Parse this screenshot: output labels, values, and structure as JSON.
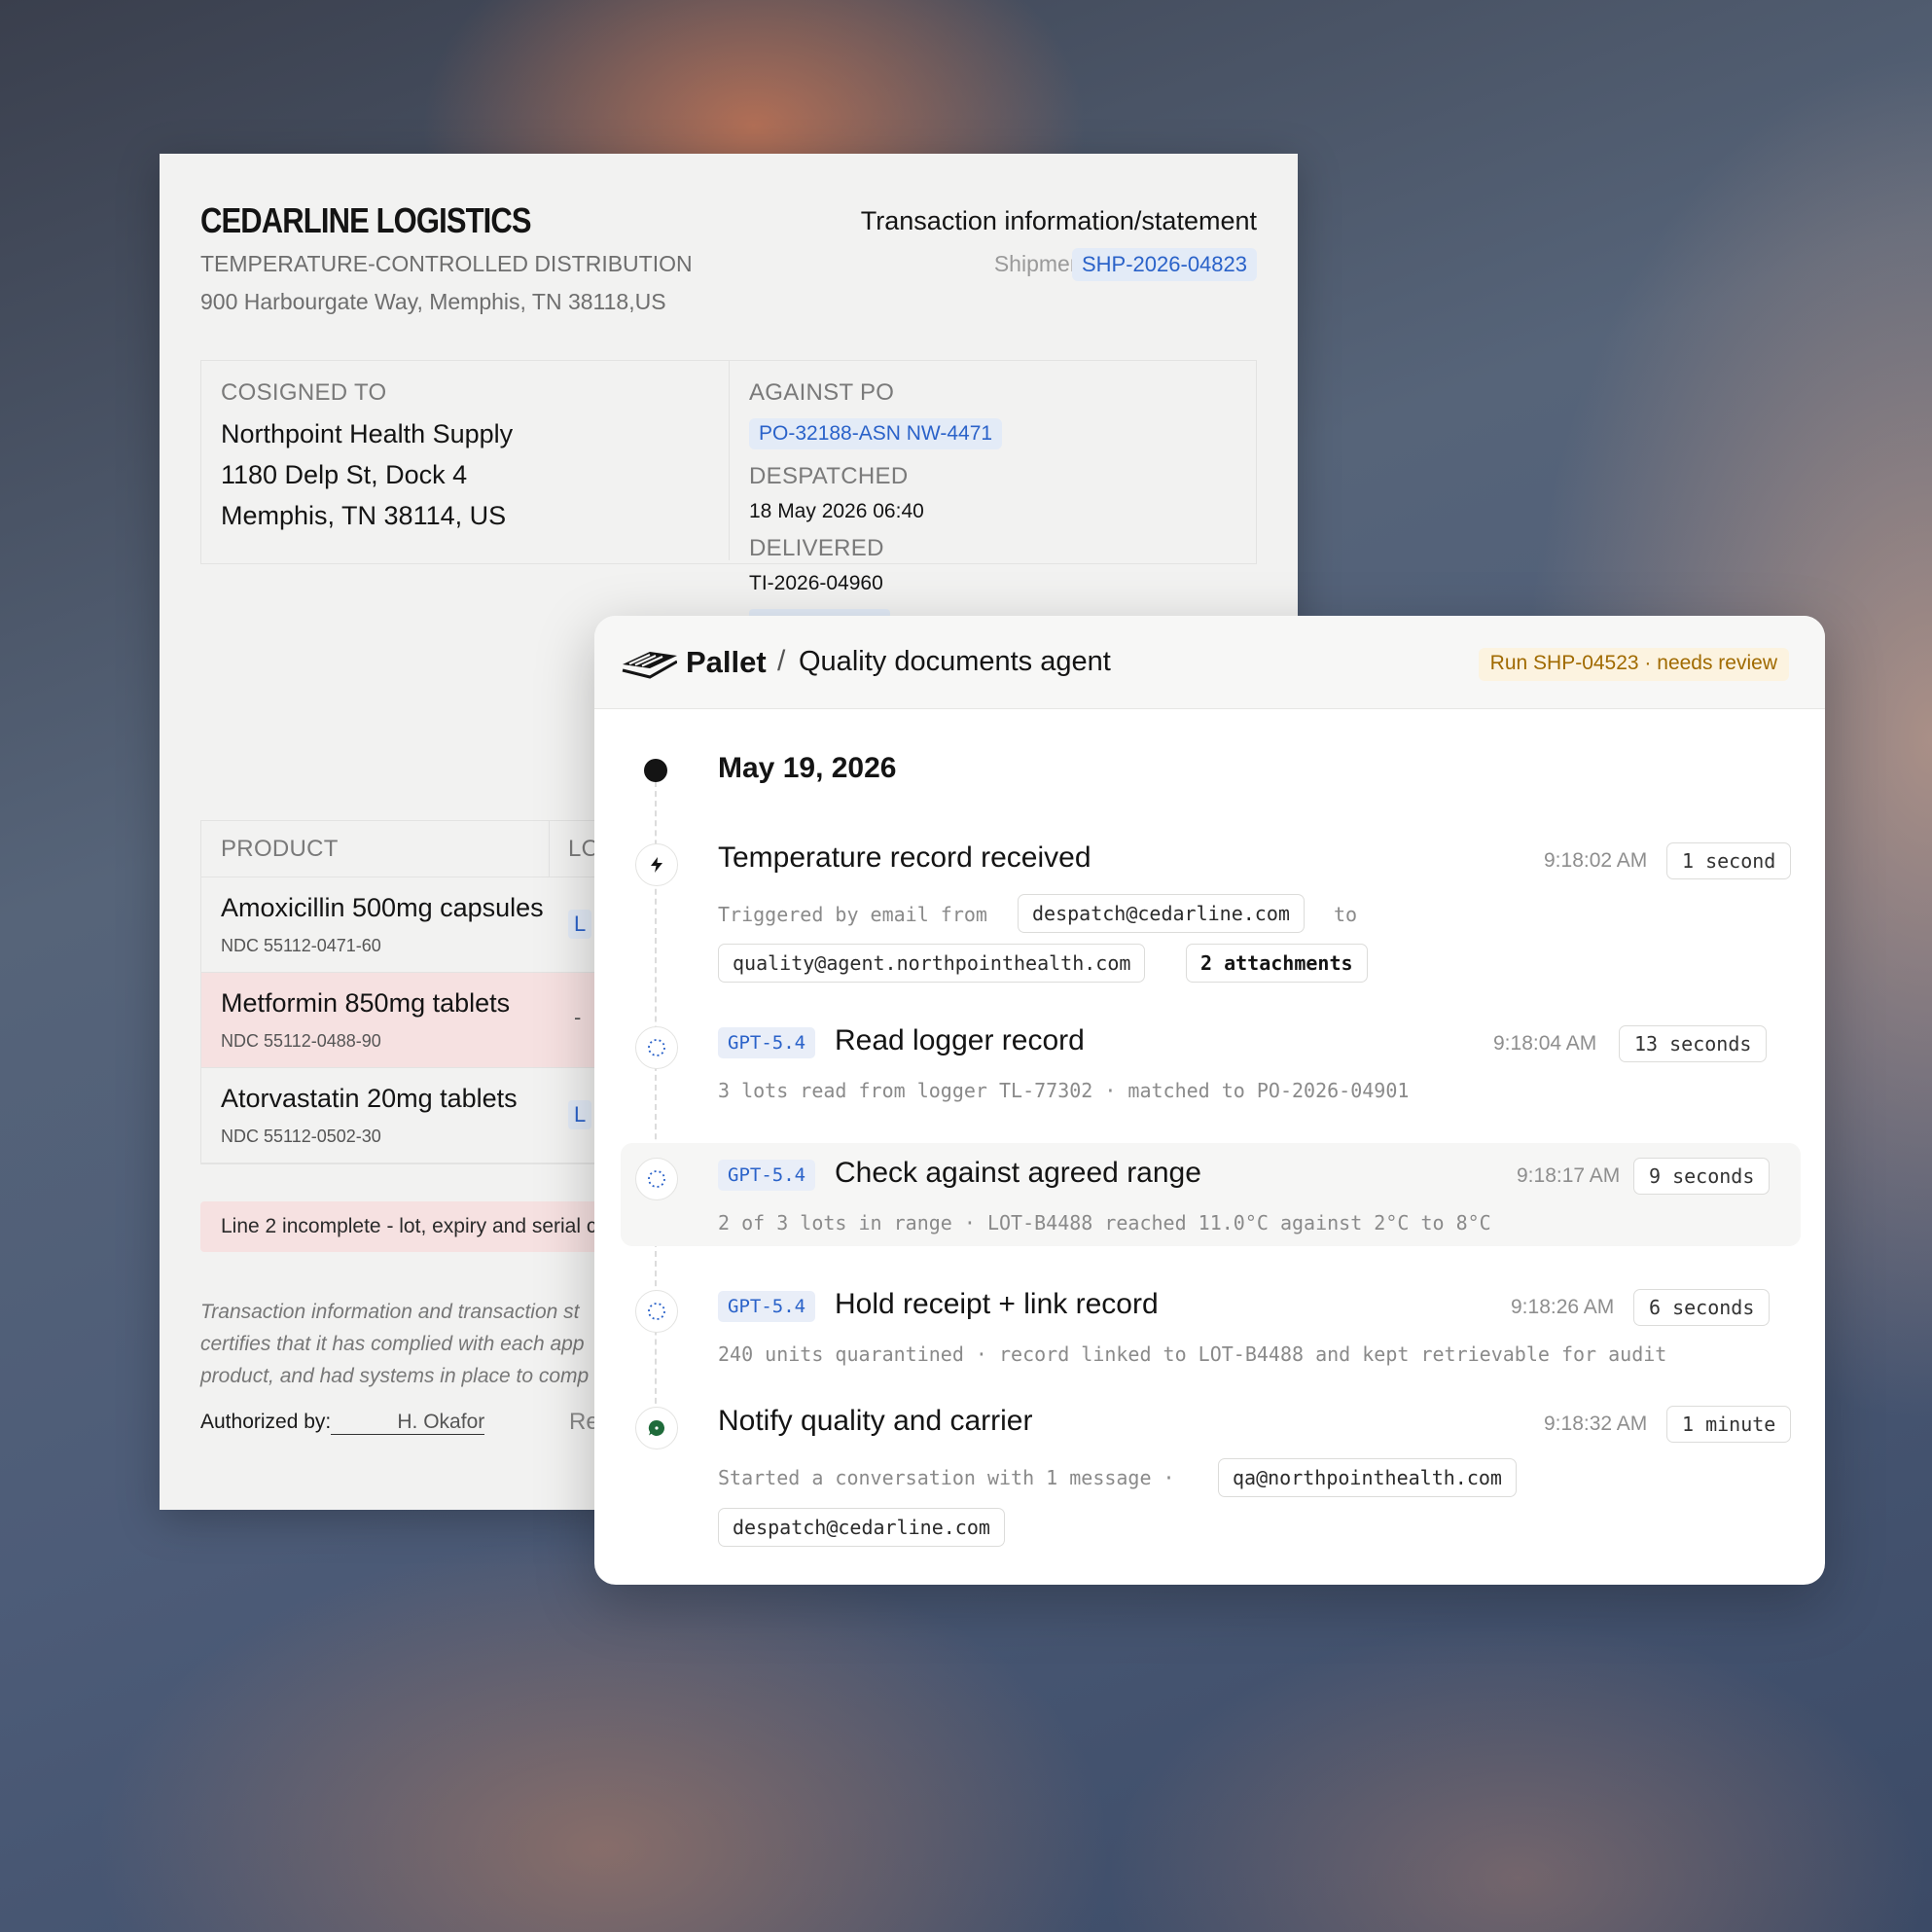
{
  "document": {
    "company": "CEDARLINE LOGISTICS",
    "division": "TEMPERATURE-CONTROLLED DISTRIBUTION",
    "address": "900 Harbourgate Way, Memphis, TN 38118,US",
    "title": "Transaction information/statement",
    "shipment_label": "Shipment",
    "shipment_id": "SHP-2026-04823",
    "consigned_label": "COSIGNED TO",
    "consignee": [
      "Northpoint Health Supply",
      "1180 Delp St, Dock 4",
      "Memphis, TN 38114, US"
    ],
    "po_label": "AGAINST PO",
    "po_value": "PO-32188-ASN NW-4471",
    "despatched_label": "DESPATCHED",
    "despatched_value": "18 May 2026 06:40",
    "delivered_label": "DELIVERED",
    "delivered_value": "TI-2026-04960",
    "table_headers": [
      "PRODUCT",
      "LO"
    ],
    "products": [
      {
        "name": "Amoxicillin 500mg capsules",
        "ndc": "NDC 55112-0471-60",
        "lot": "L",
        "flagged": false
      },
      {
        "name": "Metformin 850mg tablets",
        "ndc": "NDC 55112-0488-90",
        "lot": "-",
        "flagged": true
      },
      {
        "name": "Atorvastatin 20mg tablets",
        "ndc": "NDC 55112-0502-30",
        "lot": "L",
        "flagged": false
      }
    ],
    "warning": "Line 2 incomplete - lot, expiry and serial c",
    "statement": [
      "Transaction information and transaction st",
      "certifies that it has complied with each app",
      "product, and had systems in place to comp"
    ],
    "authorized_label": "Authorized by:",
    "authorized_name": "H. Okafor",
    "received_stub": "Re"
  },
  "panel": {
    "app_name": "Pallet",
    "separator": "/",
    "agent_name": "Quality documents agent",
    "run_badge": "Run SHP-04523 · needs review",
    "date": "May 19, 2026",
    "events": [
      {
        "title": "Temperature record received",
        "time": "9:18:02 AM",
        "duration": "1 second",
        "icon": "lightning-icon",
        "detail_prefix": "Triggered by email from",
        "from_chip": "despatch@cedarline.com",
        "detail_to": "to",
        "to_chip": "quality@agent.northpointhealth.com",
        "attachments": "2 attachments"
      },
      {
        "model": "GPT-5.4",
        "title": "Read logger record",
        "time": "9:18:04 AM",
        "duration": "13 seconds",
        "icon": "spinner-icon",
        "detail": "3 lots read from logger TL-77302 · matched to PO-2026-04901"
      },
      {
        "model": "GPT-5.4",
        "title": "Check against agreed range",
        "time": "9:18:17 AM",
        "duration": "9 seconds",
        "icon": "spinner-icon",
        "detail": "2 of 3 lots in range · LOT-B4488 reached 11.0°C against 2°C to 8°C"
      },
      {
        "model": "GPT-5.4",
        "title": "Hold receipt + link record",
        "time": "9:18:26 AM",
        "duration": "6 seconds",
        "icon": "spinner-icon",
        "detail": "240 units quarantined · record linked to LOT-B4488 and kept retrievable for audit"
      },
      {
        "title": "Notify quality and carrier",
        "time": "9:18:32 AM",
        "duration": "1 minute",
        "icon": "chat-bubble-icon",
        "detail_prefix": "Started a conversation with 1 message ·",
        "chip_1": "qa@northpointhealth.com",
        "chip_2": "despatch@cedarline.com"
      }
    ]
  },
  "colors": {
    "accent_blue": "#2a62c9",
    "flag_red_bg": "#f6e1e1",
    "review_amber": "#a06a00",
    "chat_green": "#1f6b3a"
  }
}
